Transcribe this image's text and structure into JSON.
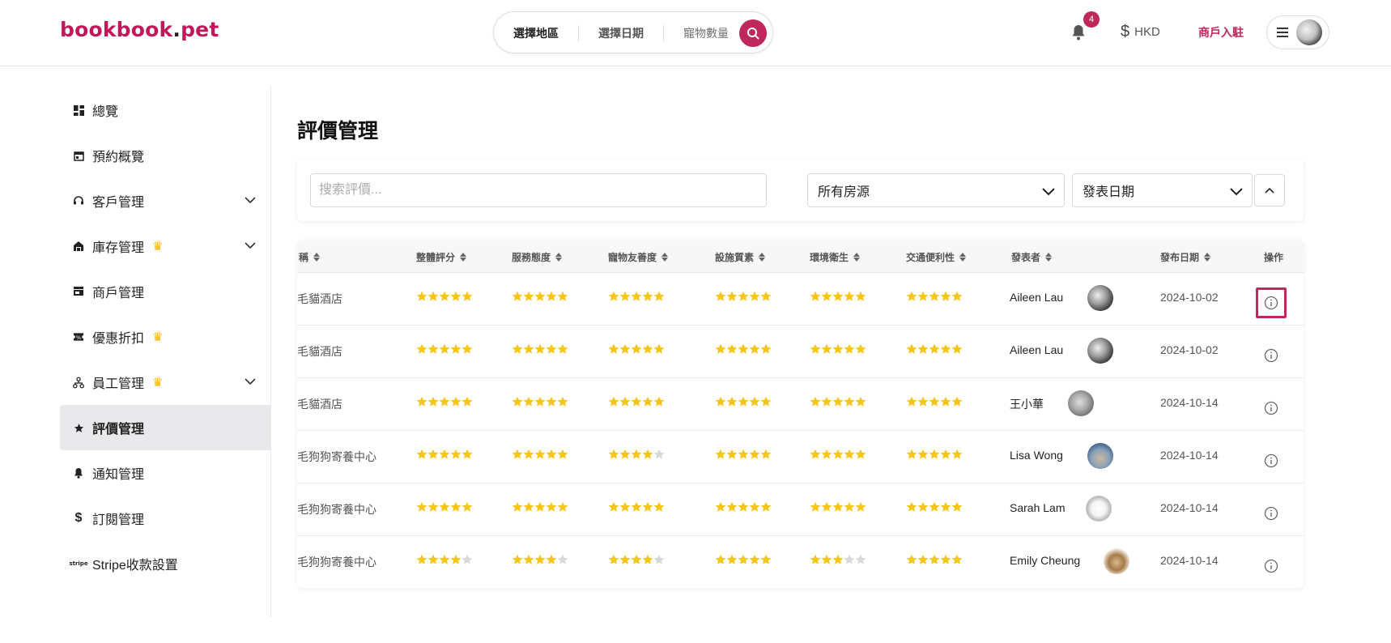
{
  "header": {
    "logo_main": "bookbook",
    "logo_dot": ".",
    "logo_tld": "pet",
    "search": {
      "region": "選擇地區",
      "date": "選擇日期",
      "pets": "寵物數量"
    },
    "notification_count": "4",
    "currency": "HKD",
    "merchant_link": "商戶入駐"
  },
  "sidebar": {
    "items": [
      {
        "label": "總覽",
        "icon": "dashboard-icon",
        "chevron": false,
        "crown": false,
        "active": false
      },
      {
        "label": "預約概覽",
        "icon": "calendar-icon",
        "chevron": false,
        "crown": false,
        "active": false
      },
      {
        "label": "客戶管理",
        "icon": "headset-icon",
        "chevron": true,
        "crown": false,
        "active": false
      },
      {
        "label": "庫存管理",
        "icon": "house-icon",
        "chevron": true,
        "crown": true,
        "active": false
      },
      {
        "label": "商戶管理",
        "icon": "store-icon",
        "chevron": false,
        "crown": false,
        "active": false
      },
      {
        "label": "優惠折扣",
        "icon": "ticket-icon",
        "chevron": false,
        "crown": true,
        "active": false
      },
      {
        "label": "員工管理",
        "icon": "org-icon",
        "chevron": true,
        "crown": true,
        "active": false
      },
      {
        "label": "評價管理",
        "icon": "star-icon",
        "chevron": false,
        "crown": false,
        "active": true
      },
      {
        "label": "通知管理",
        "icon": "bell-icon",
        "chevron": false,
        "crown": false,
        "active": false
      },
      {
        "label": "訂閱管理",
        "icon": "dollar-icon",
        "chevron": false,
        "crown": false,
        "active": false
      },
      {
        "label": "Stripe收款設置",
        "icon": "stripe-icon",
        "chevron": false,
        "crown": false,
        "active": false
      }
    ]
  },
  "main": {
    "title": "評價管理",
    "filters": {
      "search_placeholder": "搜索評價...",
      "property_select": "所有房源",
      "date_select": "發表日期"
    },
    "table": {
      "columns": [
        "稱",
        "整體評分",
        "服務態度",
        "寵物友善度",
        "設施質素",
        "環境衛生",
        "交通便利性",
        "發表者",
        "發布日期",
        "操作"
      ],
      "rows": [
        {
          "property": "毛貓酒店",
          "ratings": [
            5,
            5,
            5,
            5,
            5,
            5
          ],
          "publisher": "Aileen Lau",
          "date": "2024-10-02",
          "highlight": true
        },
        {
          "property": "毛貓酒店",
          "ratings": [
            5,
            5,
            5,
            5,
            5,
            5
          ],
          "publisher": "Aileen Lau",
          "date": "2024-10-02",
          "highlight": false
        },
        {
          "property": "毛貓酒店",
          "ratings": [
            5,
            5,
            5,
            5,
            5,
            5
          ],
          "publisher": "王小華",
          "date": "2024-10-14",
          "highlight": false
        },
        {
          "property": "毛狗狗寄養中心",
          "ratings": [
            5,
            5,
            4,
            5,
            5,
            5
          ],
          "publisher": "Lisa Wong",
          "date": "2024-10-14",
          "highlight": false
        },
        {
          "property": "毛狗狗寄養中心",
          "ratings": [
            5,
            5,
            5,
            5,
            5,
            5
          ],
          "publisher": "Sarah Lam",
          "date": "2024-10-14",
          "highlight": false
        },
        {
          "property": "毛狗狗寄養中心",
          "ratings": [
            4,
            4,
            4,
            5,
            3,
            5
          ],
          "publisher": "Emily Cheung",
          "date": "2024-10-14",
          "highlight": false
        }
      ]
    }
  },
  "colors": {
    "brand": "#c0285c",
    "star": "#f5c518",
    "star_empty": "#d8d8d8"
  }
}
